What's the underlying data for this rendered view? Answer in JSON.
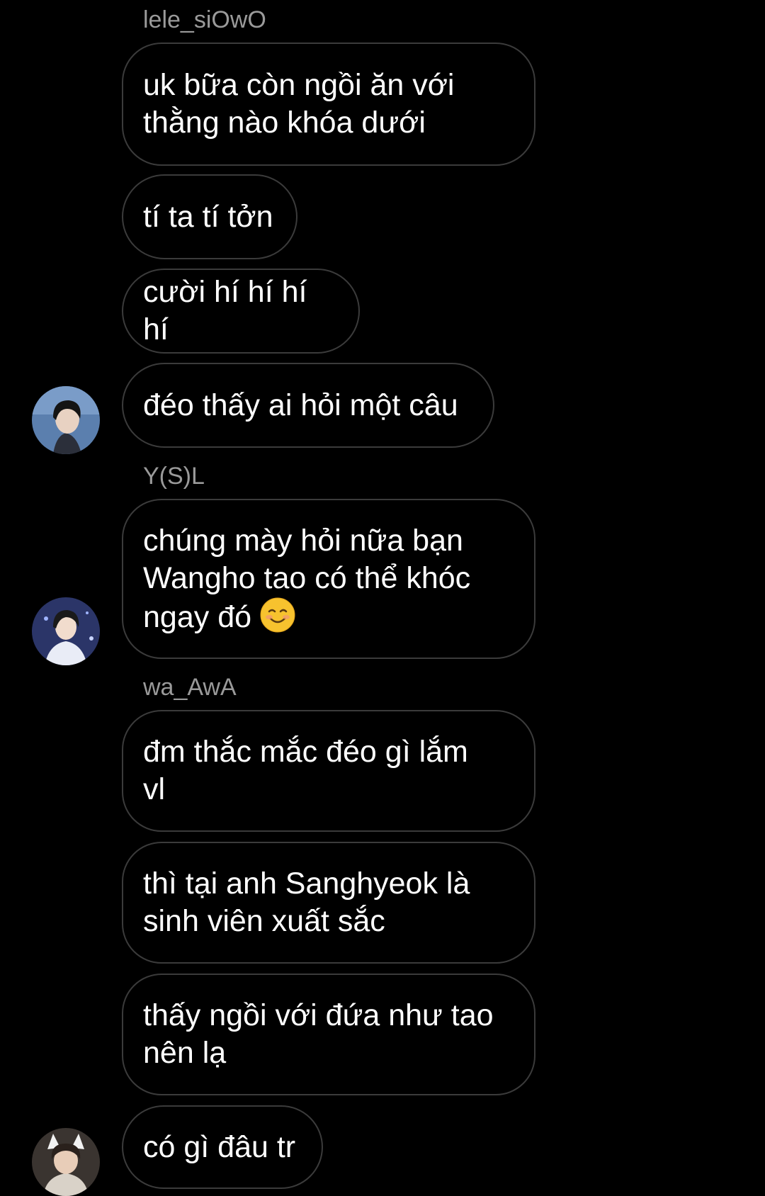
{
  "conversation": {
    "groups": [
      {
        "sender": "lele_siOwO",
        "messages": [
          "uk bữa còn ngồi ăn với\nthằng nào khóa dưới",
          "tí ta tí tởn",
          "cười hí hí hí hí",
          "đéo thấy ai hỏi một câu"
        ]
      },
      {
        "sender": "Y(S)L",
        "messages": [
          "chúng mày hỏi nữa bạn\nWangho tao có thể khóc\nngay đó"
        ],
        "emoji": "smiling-face-emoji"
      },
      {
        "sender": "wa_AwA",
        "messages": [
          "đm thắc mắc đéo gì lắm\nvl",
          "thì tại anh Sanghyeok là\nsinh viên xuất sắc",
          "thấy ngồi với đứa như tao\nnên lạ",
          "có gì đâu tr"
        ]
      }
    ]
  },
  "icons": {
    "avatar_1": "avatar-photo-dark-hair",
    "avatar_2": "avatar-photo-white-shirt",
    "avatar_3": "avatar-photo-cat-ears"
  },
  "colors": {
    "background": "#000000",
    "bubble_border": "#3b3b3b",
    "sender_name": "#9a9a9a",
    "message_text": "#ffffff"
  }
}
